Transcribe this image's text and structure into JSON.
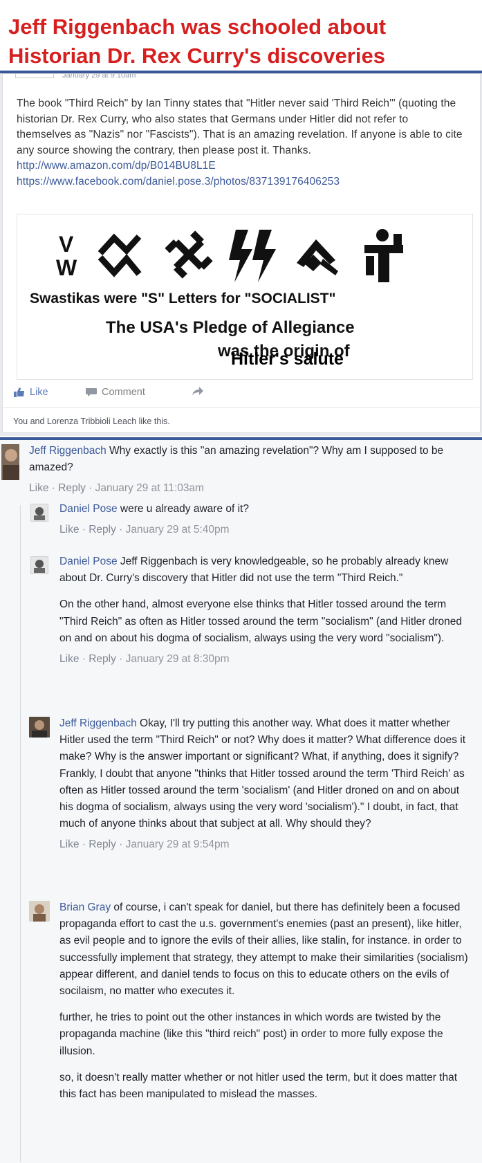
{
  "headline": {
    "line1": "Jeff Riggenbach was schooled about",
    "line2": "Historian Dr. Rex Curry's discoveries"
  },
  "colors": {
    "headline": "#d62020",
    "rule": "#3b5998",
    "link": "#3b5998"
  },
  "post": {
    "meta": "January 29 at 9:10am",
    "body": "The book \"Third Reich\" by Ian Tinny states that \"Hitler never said 'Third Reich'\" (quoting the historian Dr. Rex Curry, who also states that Germans under Hitler did not refer to themselves as \"Nazis\" nor \"Fascists\"). That is an amazing revelation. If anyone is able to cite any source showing the contrary, then please post it. Thanks.",
    "link1": "http://www.amazon.com/dp/B014BU8L1E",
    "link2": "https://www.facebook.com/daniel.pose.3/photos/837139176406253",
    "image": {
      "v_letter": "V",
      "w_letter": "W",
      "caption1": "Swastikas were \"S\" Letters for \"SOCIALIST\"",
      "caption2": "The USA's Pledge of Allegiance",
      "caption3": "was the origin of",
      "caption4": "Hitler's salute"
    },
    "actions": {
      "like": "Like",
      "comment": "Comment",
      "share_icon": "share-arrow-icon"
    },
    "likes_line": "You and Lorenza Tribbioli Leach like this."
  },
  "comments": [
    {
      "author": "Jeff Riggenbach",
      "text": " Why exactly is this \"an amazing revelation\"? Why am I supposed to be amazed?",
      "paragraphs": [],
      "like": "Like",
      "reply": "Reply",
      "time": "January 29 at 11:03am"
    },
    {
      "author": "Daniel Pose",
      "text": " were u already aware of it?",
      "paragraphs": [],
      "like": "Like",
      "reply": "Reply",
      "time": "January 29 at 5:40pm"
    },
    {
      "author": "Daniel Pose",
      "text": " Jeff Riggenbach is very knowledgeable, so he probably already knew about Dr. Curry's discovery that Hitler did not use the term \"Third Reich.\"",
      "paragraphs": [
        "On the other hand, almost everyone else thinks that Hitler tossed around the term \"Third Reich\" as often as Hitler tossed around the term \"socialism\" (and Hitler droned on and on about his dogma of socialism, always using the very word \"socialism\")."
      ],
      "like": "Like",
      "reply": "Reply",
      "time": "January 29 at 8:30pm"
    },
    {
      "author": "Jeff Riggenbach",
      "text": " Okay, I'll try putting this another way. What does it matter whether Hitler used the term \"Third Reich\" or not? Why does it matter? What difference does it make? Why is the answer important or significant? What, if anything, does it signify? Frankly, I doubt that anyone \"thinks that Hitler tossed around the term 'Third Reich' as often as Hitler tossed around the term 'socialism' (and Hitler droned on and on about his dogma of socialism, always using the very word 'socialism').\" I doubt, in fact, that much of anyone thinks about that subject at all. Why should they?",
      "paragraphs": [],
      "like": "Like",
      "reply": "Reply",
      "time": "January 29 at 9:54pm"
    },
    {
      "author": "Brian Gray",
      "text": " of course, i can't speak for daniel, but there has definitely been a focused propaganda effort to cast the u.s. government's enemies (past an present), like hitler, as evil people and to ignore the evils of their allies, like stalin, for instance. in order to successfully implement that strategy, they attempt to make their similarities (socialism) appear different, and daniel tends to focus on this to educate others on the evils of socilaism, no matter who executes it.",
      "paragraphs": [
        "further, he tries to point out the other instances in which words are twisted by the propaganda machine (like this \"third reich\" post) in order to more fully expose the illusion.",
        "so, it doesn't really matter whether or not hitler used the term, but it does matter that this fact has been manipulated to mislead the masses."
      ],
      "like": "",
      "reply": "",
      "time": ""
    }
  ]
}
